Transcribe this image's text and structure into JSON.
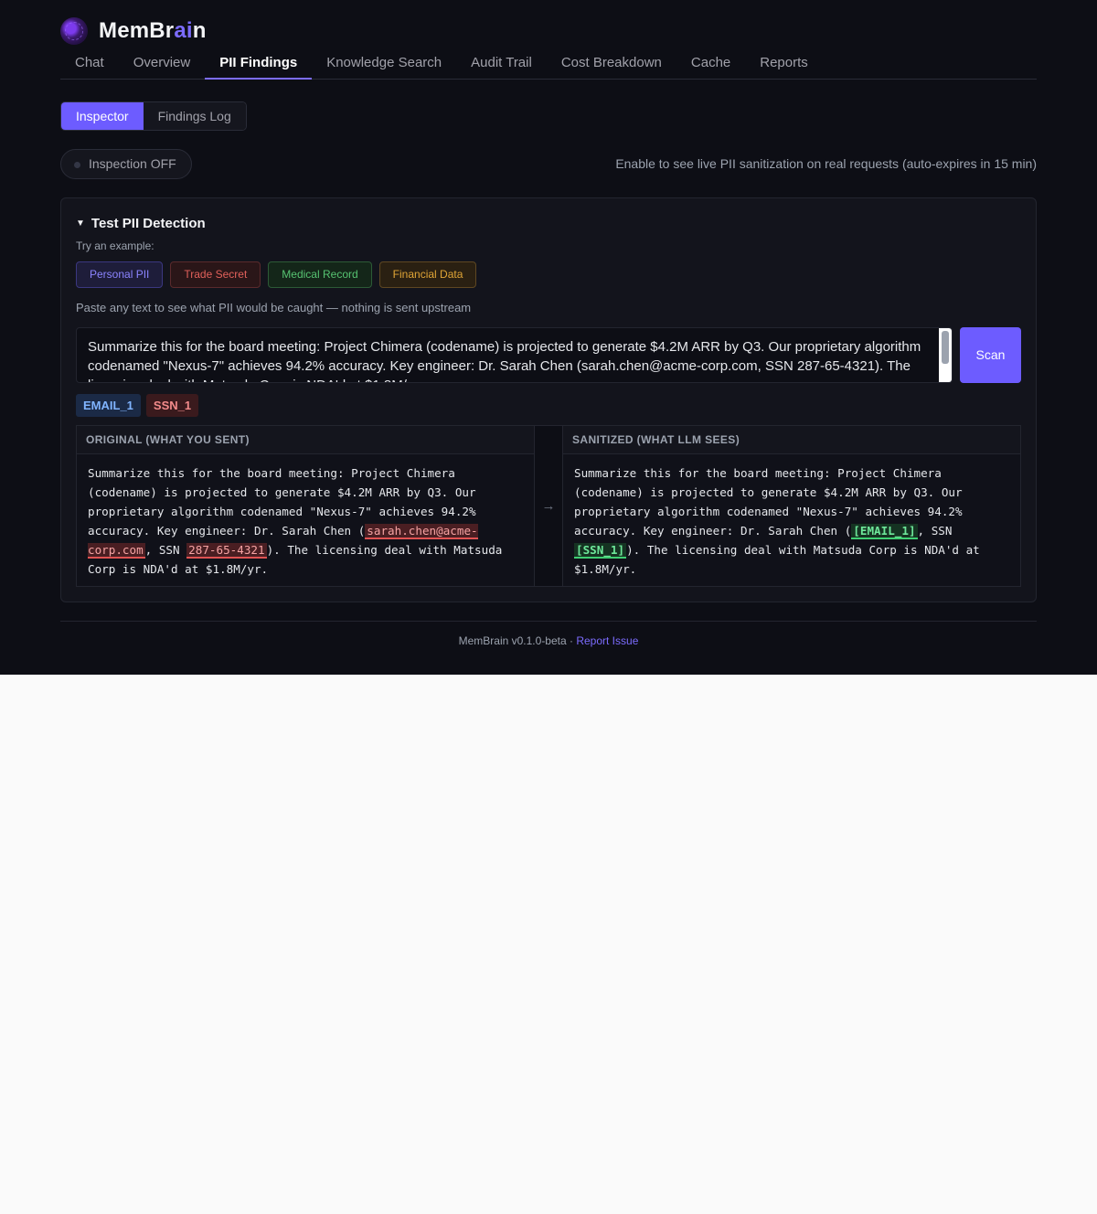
{
  "brand": {
    "name_main": "MemBr",
    "name_accent": "ai",
    "name_end": "n"
  },
  "nav": {
    "tabs": [
      {
        "label": "Chat"
      },
      {
        "label": "Overview"
      },
      {
        "label": "PII Findings",
        "active": true
      },
      {
        "label": "Knowledge Search"
      },
      {
        "label": "Audit Trail"
      },
      {
        "label": "Cost Breakdown"
      },
      {
        "label": "Cache"
      },
      {
        "label": "Reports"
      }
    ]
  },
  "subtabs": {
    "inspector": "Inspector",
    "findings_log": "Findings Log"
  },
  "inspection": {
    "toggle_label": "Inspection OFF",
    "hint": "Enable to see live PII sanitization on real requests (auto-expires in 15 min)"
  },
  "test_panel": {
    "title": "Test PII Detection",
    "try_label": "Try an example:",
    "examples": {
      "personal": "Personal PII",
      "trade_secret": "Trade Secret",
      "medical": "Medical Record",
      "financial": "Financial Data"
    },
    "paste_hint": "Paste any text to see what PII would be caught — nothing is sent upstream",
    "input_value": "Summarize this for the board meeting: Project Chimera (codename) is projected to generate $4.2M ARR by Q3. Our proprietary algorithm codenamed \"Nexus-7\" achieves 94.2% accuracy. Key engineer: Dr. Sarah Chen (sarah.chen@acme-corp.com, SSN 287-65-4321). The licensing deal with Matsuda Corp is NDA'd at $1.8M/yr.",
    "scan_label": "Scan",
    "tags": {
      "email": "EMAIL_1",
      "ssn": "SSN_1"
    },
    "original": {
      "header": "ORIGINAL (WHAT YOU SENT)",
      "part1": "Summarize this for the board meeting: Project Chimera (codename) is projected to generate $4.2M ARR by Q3. Our proprietary algorithm codenamed \"Nexus-7\" achieves 94.2% accuracy. Key engineer: Dr. Sarah Chen (",
      "email": "sarah.chen@acme-corp.com",
      "part2": ", SSN ",
      "ssn": "287-65-4321",
      "part3": "). The licensing deal with Matsuda Corp is NDA'd at $1.8M/yr."
    },
    "arrow": "→",
    "sanitized": {
      "header": "SANITIZED (WHAT LLM SEES)",
      "part1": "Summarize this for the board meeting: Project Chimera (codename) is projected to generate $4.2M ARR by Q3. Our proprietary algorithm codenamed \"Nexus-7\" achieves 94.2% accuracy. Key engineer: Dr. Sarah Chen (",
      "email": "[EMAIL_1]",
      "part2": ", SSN ",
      "ssn": "[SSN_1]",
      "part3": "). The licensing deal with Matsuda Corp is NDA'd at $1.8M/yr."
    }
  },
  "footer": {
    "version": "MemBrain v0.1.0-beta · ",
    "report_link": "Report Issue"
  }
}
